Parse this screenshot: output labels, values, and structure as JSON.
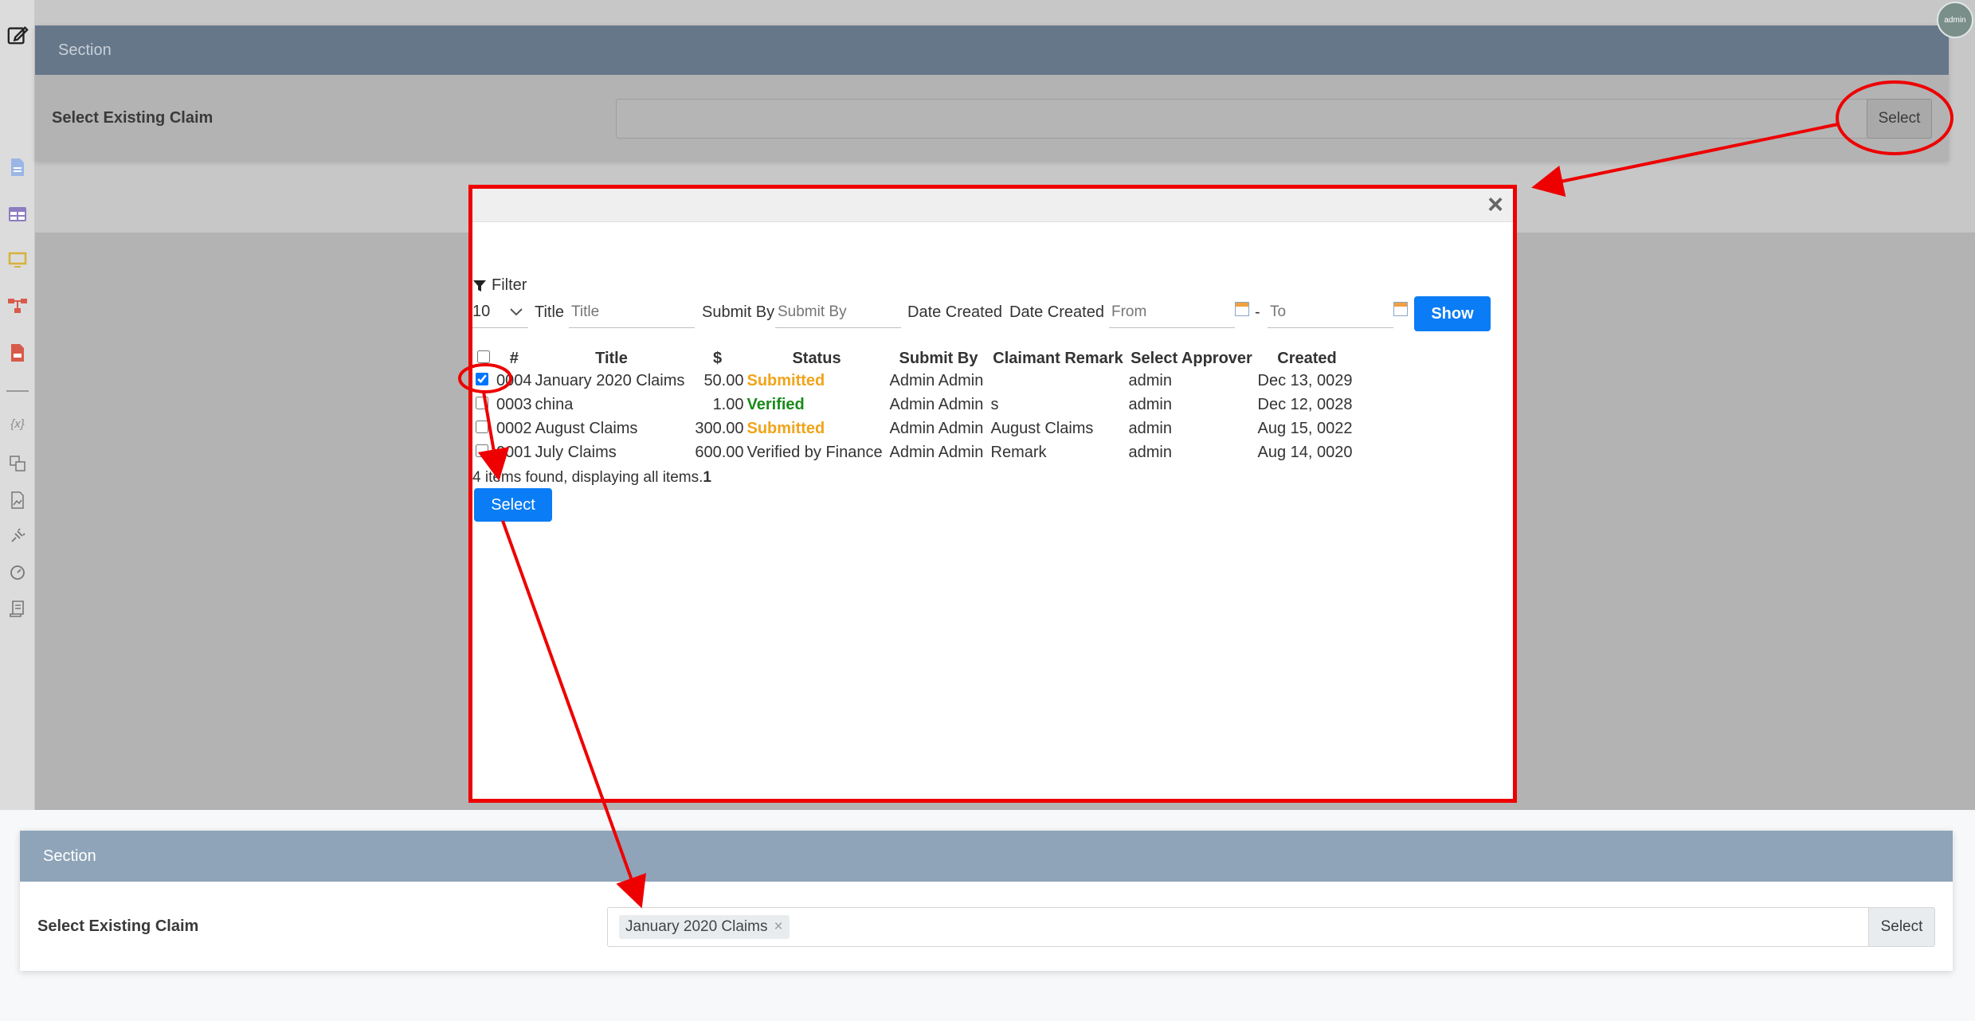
{
  "top_section": {
    "header": "Section",
    "claim_label": "Select Existing Claim",
    "select_button": "Select"
  },
  "user": {
    "avatar_text": "admin"
  },
  "sidebar": {
    "icons": [
      "edit-icon",
      "document-icon",
      "table-icon",
      "monitor-icon",
      "workflow-icon",
      "pdf-icon",
      "variable-icon",
      "translate-icon",
      "image-file-icon",
      "plug-icon",
      "gauge-icon",
      "script-icon"
    ],
    "variable_glyph": "{x}"
  },
  "modal": {
    "close_glyph": "×",
    "filter_label": "Filter",
    "page_size": "10",
    "page_size_options": [
      "10"
    ],
    "title_label": "Title",
    "title_placeholder": "Title",
    "submit_by_label": "Submit By",
    "submit_by_placeholder": "Submit By",
    "date_created_label_1": "Date Created",
    "date_created_label_2": "Date Created",
    "from_placeholder": "From",
    "range_separator": "-",
    "to_placeholder": "To",
    "show_button": "Show",
    "table": {
      "headers": [
        "#",
        "Title",
        "$",
        "Status",
        "Submit By",
        "Claimant Remark",
        "Select Approver",
        "Created"
      ],
      "rows": [
        {
          "checked": true,
          "num": "0004",
          "title": "January 2020 Claims",
          "amount": "50.00",
          "status": "Submitted",
          "status_kind": "submitted",
          "submit_by": "Admin Admin",
          "remark": "",
          "approver": "admin",
          "created": "Dec 13, 0029"
        },
        {
          "checked": false,
          "num": "0003",
          "title": "china",
          "amount": "1.00",
          "status": "Verified",
          "status_kind": "verified",
          "submit_by": "Admin Admin",
          "remark": "s",
          "approver": "admin",
          "created": "Dec 12, 0028"
        },
        {
          "checked": false,
          "num": "0002",
          "title": "August Claims",
          "amount": "300.00",
          "status": "Submitted",
          "status_kind": "submitted",
          "submit_by": "Admin Admin",
          "remark": "August Claims",
          "approver": "admin",
          "created": "Aug 15, 0022"
        },
        {
          "checked": false,
          "num": "0001",
          "title": "July Claims",
          "amount": "600.00",
          "status": "Verified by Finance",
          "status_kind": "plain",
          "submit_by": "Admin Admin",
          "remark": "Remark",
          "approver": "admin",
          "created": "Aug 14, 0020"
        }
      ]
    },
    "found_text": "4 items found, displaying all items.",
    "page_number": "1",
    "select_button": "Select"
  },
  "bottom_section": {
    "header": "Section",
    "claim_label": "Select Existing Claim",
    "selected_tag": "January 2020 Claims",
    "tag_remove_glyph": "×",
    "select_button": "Select"
  },
  "colors": {
    "annotation_red": "#ee0000",
    "primary_blue": "#0a7cf5",
    "status_submitted": "#f0a41a",
    "status_verified": "#1a8a1a",
    "dim_header": "#66778a",
    "section_header": "#8fa4b9"
  }
}
